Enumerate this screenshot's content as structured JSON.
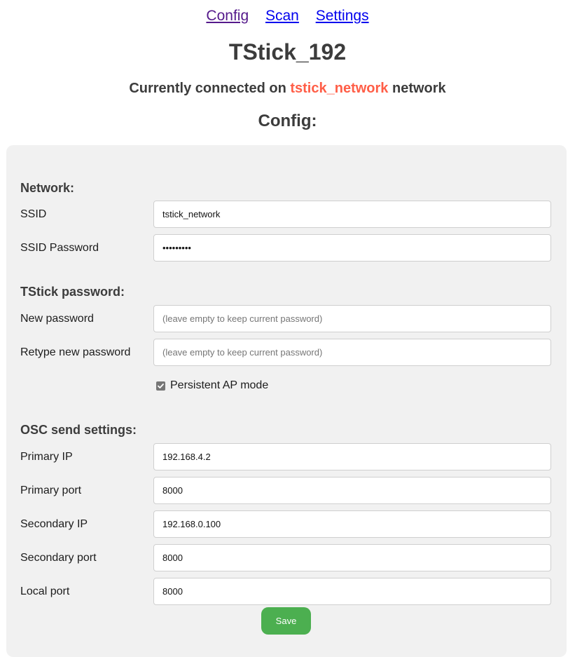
{
  "nav": {
    "links": [
      {
        "label": "Config",
        "state": "visited"
      },
      {
        "label": "Scan",
        "state": "link"
      },
      {
        "label": "Settings",
        "state": "link"
      }
    ]
  },
  "header": {
    "title": "TStick_192",
    "status_prefix": "Currently connected on ",
    "status_network": "tstick_network",
    "status_suffix": " network",
    "subtitle": "Config:"
  },
  "colors": {
    "network_highlight": "#ff5e47",
    "save_button": "#4caf50",
    "panel_background": "#f1f1f1",
    "visited_link": "#551a8b",
    "link": "#0000ee"
  },
  "form": {
    "network": {
      "title": "Network:",
      "ssid_label": "SSID",
      "ssid_value": "tstick_network",
      "ssid_password_label": "SSID Password",
      "ssid_password_value": "•••••••••"
    },
    "tstick_password": {
      "title": "TStick password:",
      "new_password_label": "New password",
      "new_password_placeholder": "(leave empty to keep current password)",
      "retype_password_label": "Retype new password",
      "retype_password_placeholder": "(leave empty to keep current password)",
      "persistent_ap_label": "Persistent AP mode",
      "persistent_ap_checked": true
    },
    "osc": {
      "title": "OSC send settings:",
      "primary_ip_label": "Primary IP",
      "primary_ip_value": "192.168.4.2",
      "primary_port_label": "Primary port",
      "primary_port_value": "8000",
      "secondary_ip_label": "Secondary IP",
      "secondary_ip_value": "192.168.0.100",
      "secondary_port_label": "Secondary port",
      "secondary_port_value": "8000",
      "local_port_label": "Local port",
      "local_port_value": "8000"
    },
    "save_label": "Save"
  }
}
